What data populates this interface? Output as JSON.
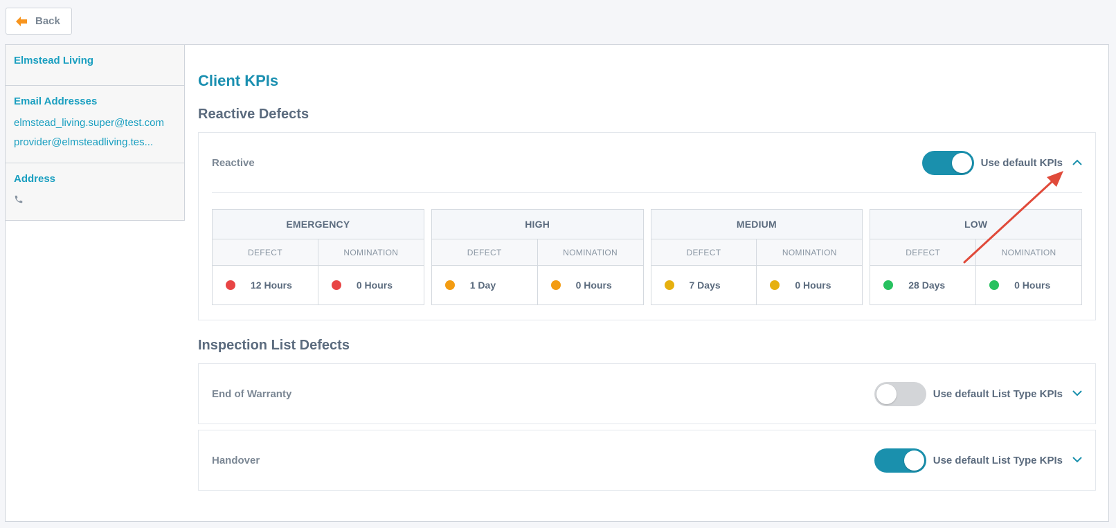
{
  "back": {
    "label": "Back",
    "icon": "arrow-left-icon",
    "icon_color": "#f7941d"
  },
  "sidebar": {
    "company": "Elmstead Living",
    "emails_title": "Email Addresses",
    "emails": [
      "elmstead_living.super@test.com",
      "provider@elmsteadliving.tes..."
    ],
    "address_title": "Address",
    "phone_icon": "phone-icon"
  },
  "main": {
    "title": "Client KPIs",
    "reactive_section": "Reactive Defects",
    "reactive": {
      "label": "Reactive",
      "toggle_on": true,
      "toggle_label": "Use default KPIs",
      "expanded": true,
      "sub_headers": [
        "DEFECT",
        "NOMINATION"
      ],
      "priorities": [
        {
          "name": "EMERGENCY",
          "color": "#e84545",
          "defect": "12 Hours",
          "nomination": "0 Hours"
        },
        {
          "name": "HIGH",
          "color": "#f39c12",
          "defect": "1 Day",
          "nomination": "0 Hours"
        },
        {
          "name": "MEDIUM",
          "color": "#e6b00f",
          "defect": "7 Days",
          "nomination": "0 Hours"
        },
        {
          "name": "LOW",
          "color": "#27c15f",
          "defect": "28 Days",
          "nomination": "0 Hours"
        }
      ]
    },
    "inspection_section": "Inspection List Defects",
    "inspection": [
      {
        "label": "End of Warranty",
        "toggle_on": false,
        "toggle_label": "Use default List Type KPIs"
      },
      {
        "label": "Handover",
        "toggle_on": true,
        "toggle_label": "Use default List Type KPIs"
      }
    ]
  },
  "colors": {
    "accent": "#1a90ad",
    "link": "#1a9fc0",
    "annotation_arrow": "#e04a3a"
  }
}
